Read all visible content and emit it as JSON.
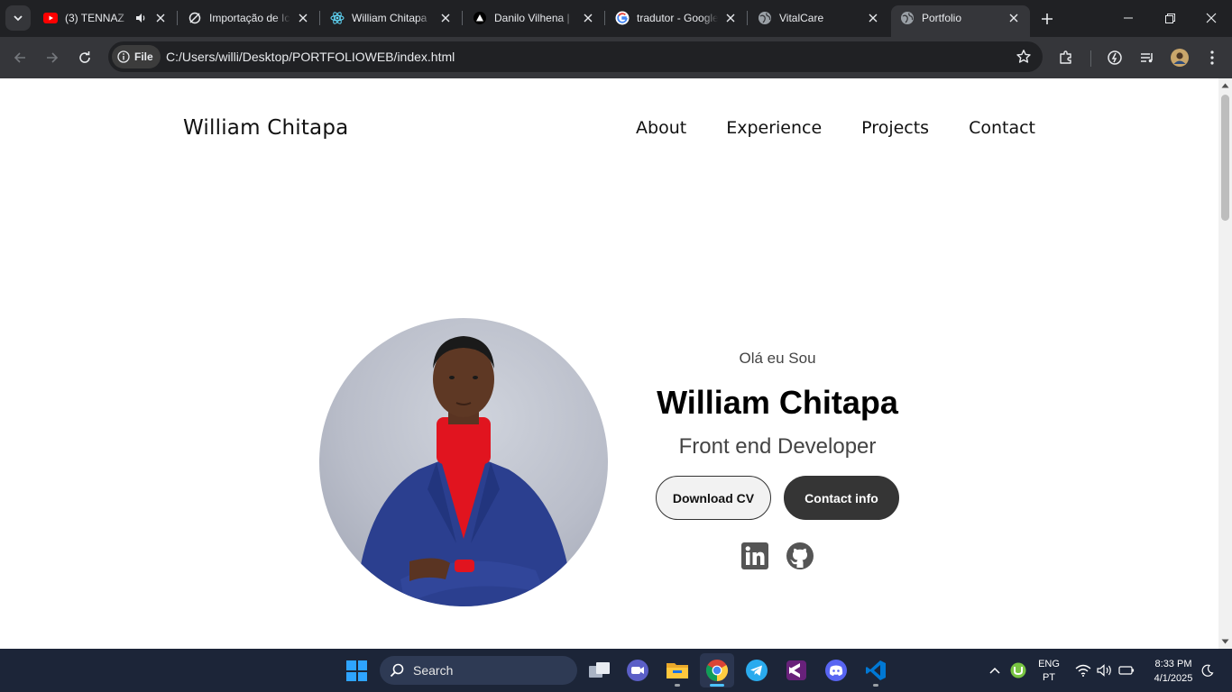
{
  "browser": {
    "tabs": [
      {
        "title": "(3) TENNAZ",
        "favicon": "youtube-icon",
        "audio": true
      },
      {
        "title": "Importação de Ic",
        "favicon": "leaf-icon"
      },
      {
        "title": "William Chitapa",
        "favicon": "react-icon"
      },
      {
        "title": "Danilo Vilhena |",
        "favicon": "vercel-icon"
      },
      {
        "title": "tradutor - Google",
        "favicon": "google-icon"
      },
      {
        "title": "VitalCare",
        "favicon": "globe-icon"
      },
      {
        "title": "Portfolio",
        "favicon": "globe-icon",
        "active": true
      }
    ],
    "address": {
      "chip_label": "File",
      "url": "C:/Users/willi/Desktop/PORTFOLIOWEB/index.html"
    }
  },
  "page": {
    "logo": "William Chitapa",
    "nav": [
      "About",
      "Experience",
      "Projects",
      "Contact"
    ],
    "hero": {
      "greeting": "Olá eu Sou",
      "name": "William Chitapa",
      "role": "Front end Developer",
      "download_cv": "Download CV",
      "contact_info": "Contact info"
    },
    "socials": [
      "linkedin-icon",
      "github-icon"
    ]
  },
  "taskbar": {
    "search_label": "Search",
    "language": {
      "line1": "ENG",
      "line2": "PT"
    },
    "clock": {
      "time": "8:33 PM",
      "date": "4/1/2025"
    },
    "apps": [
      "task-view-icon",
      "meet-icon",
      "file-explorer-icon",
      "chrome-icon",
      "telegram-icon",
      "visual-studio-icon",
      "discord-icon",
      "vscode-icon"
    ]
  },
  "colors": {
    "tab_strip": "#202124",
    "toolbar": "#35363a",
    "taskbar": "#1c2538",
    "button_dark": "#353535"
  }
}
